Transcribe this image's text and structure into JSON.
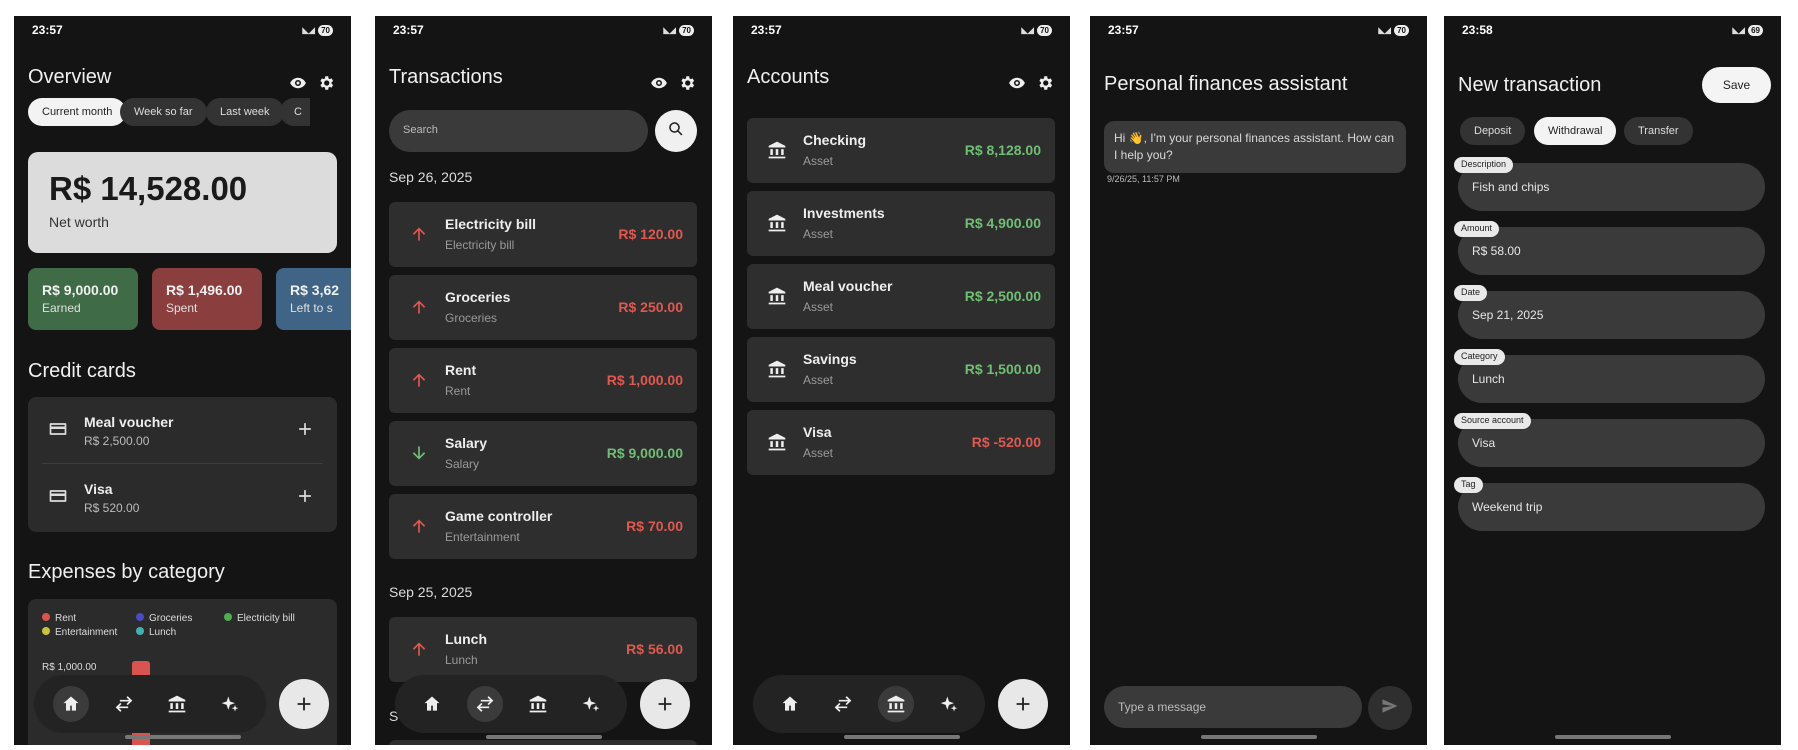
{
  "screens": {
    "overview": {
      "time": "23:57",
      "battery": "70",
      "title": "Overview",
      "chips": [
        "Current month",
        "Week so far",
        "Last week",
        "C"
      ],
      "net_worth": {
        "value": "R$ 14,528.00",
        "label": "Net worth"
      },
      "summary": [
        {
          "value": "R$ 9,000.00",
          "label": "Earned",
          "color": "#3f6b47"
        },
        {
          "value": "R$ 1,496.00",
          "label": "Spent",
          "color": "#8a3e3e"
        },
        {
          "value": "R$ 3,62",
          "label": "Left to s",
          "color": "#3f6485"
        }
      ],
      "credit_title": "Credit cards",
      "credit_cards": [
        {
          "name": "Meal voucher",
          "amount": "R$ 2,500.00"
        },
        {
          "name": "Visa",
          "amount": "R$ 520.00"
        }
      ],
      "expenses_title": "Expenses by category",
      "legend": [
        {
          "name": "Rent",
          "color": "#d9534f"
        },
        {
          "name": "Groceries",
          "color": "#4b4bc8"
        },
        {
          "name": "Electricity bill",
          "color": "#4caf50"
        },
        {
          "name": "Entertainment",
          "color": "#c9c43a"
        },
        {
          "name": "Lunch",
          "color": "#3fb3b3"
        }
      ],
      "axis_label": "R$ 1,000.00",
      "chart_data": {
        "type": "bar",
        "categories": [
          "Rent"
        ],
        "values": [
          1000
        ],
        "ylabel": ""
      }
    },
    "transactions": {
      "time": "23:57",
      "battery": "70",
      "title": "Transactions",
      "search_placeholder": "Search",
      "groups": [
        {
          "date": "Sep 26, 2025",
          "items": [
            {
              "name": "Electricity bill",
              "sub": "Electricity bill",
              "amount": "R$ 120.00",
              "dir": "out"
            },
            {
              "name": "Groceries",
              "sub": "Groceries",
              "amount": "R$ 250.00",
              "dir": "out"
            },
            {
              "name": "Rent",
              "sub": "Rent",
              "amount": "R$ 1,000.00",
              "dir": "out"
            },
            {
              "name": "Salary",
              "sub": "Salary",
              "amount": "R$ 9,000.00",
              "dir": "in"
            },
            {
              "name": "Game controller",
              "sub": "Entertainment",
              "amount": "R$ 70.00",
              "dir": "out"
            }
          ]
        },
        {
          "date": "Sep 25, 2025",
          "items": [
            {
              "name": "Lunch",
              "sub": "Lunch",
              "amount": "R$ 56.00",
              "dir": "out"
            }
          ]
        }
      ],
      "partial_label": "S"
    },
    "accounts": {
      "time": "23:57",
      "battery": "70",
      "title": "Accounts",
      "items": [
        {
          "name": "Checking",
          "sub": "Asset",
          "amount": "R$ 8,128.00",
          "positive": true
        },
        {
          "name": "Investments",
          "sub": "Asset",
          "amount": "R$ 4,900.00",
          "positive": true
        },
        {
          "name": "Meal voucher",
          "sub": "Asset",
          "amount": "R$ 2,500.00",
          "positive": true
        },
        {
          "name": "Savings",
          "sub": "Asset",
          "amount": "R$ 1,500.00",
          "positive": true
        },
        {
          "name": "Visa",
          "sub": "Asset",
          "amount": "R$ -520.00",
          "positive": false
        }
      ]
    },
    "assistant": {
      "time": "23:57",
      "battery": "70",
      "title": "Personal finances assistant",
      "message": "Hi 👋, I'm your personal finances assistant. How can I help you?",
      "timestamp": "9/26/25, 11:57 PM",
      "input_placeholder": "Type a message"
    },
    "new_transaction": {
      "time": "23:58",
      "battery": "69",
      "title": "New transaction",
      "save_label": "Save",
      "types": [
        "Deposit",
        "Withdrawal",
        "Transfer"
      ],
      "selected_type": "Withdrawal",
      "fields": [
        {
          "label": "Description",
          "value": "Fish and chips"
        },
        {
          "label": "Amount",
          "value": "R$ 58.00"
        },
        {
          "label": "Date",
          "value": "Sep 21, 2025"
        },
        {
          "label": "Category",
          "value": "Lunch"
        },
        {
          "label": "Source account",
          "value": "Visa"
        },
        {
          "label": "Tag",
          "value": "Weekend trip"
        }
      ]
    }
  }
}
